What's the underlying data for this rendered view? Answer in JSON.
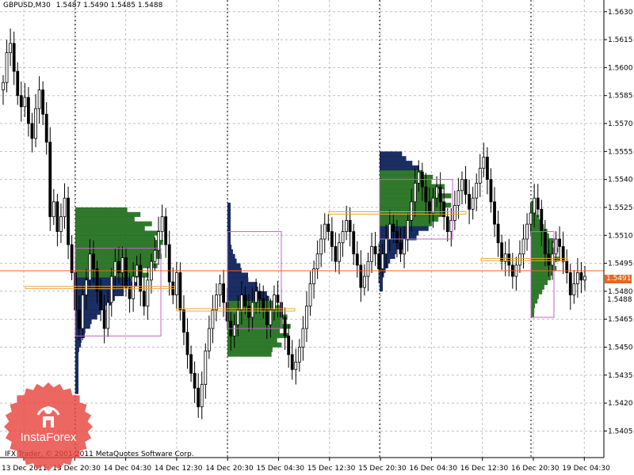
{
  "window": {
    "symbol": "GBPUSD,M30",
    "ohlc": "1.5487 1.5490 1.5485 1.5488",
    "copyright": "IFX Trader, © 2001-2011 MetaQuotes Software Corp.",
    "current_price": "1.5491",
    "last_price": "1.5488"
  },
  "watermark": {
    "text": "InstaForex",
    "color": "#e8463f"
  },
  "colors": {
    "background": "#ffffff",
    "grid": "#c0c0c0",
    "candle": "#000000",
    "profile_dark": "#071c55",
    "profile_green": "#1e6e1a",
    "value_area_box": "#c264c8",
    "poc_line": "#e8a83a",
    "price_line": "#e8661f",
    "separator": "#000000"
  },
  "chart_data": {
    "type": "candlestick",
    "symbol": "GBPUSD",
    "timeframe": "M30",
    "y_axis": {
      "ylim": [
        1.5395,
        1.5635
      ],
      "ticks": [
        "1.5630",
        "1.5615",
        "1.5600",
        "1.5585",
        "1.5570",
        "1.5555",
        "1.5540",
        "1.5525",
        "1.5510",
        "1.5495",
        "1.5480",
        "1.5465",
        "1.5450",
        "1.5435",
        "1.5420",
        "1.5405"
      ]
    },
    "x_axis": {
      "ticks": [
        "13 Dec 2011",
        "13 Dec 20:30",
        "14 Dec 04:30",
        "14 Dec 12:30",
        "14 Dec 20:30",
        "15 Dec 04:30",
        "15 Dec 12:30",
        "15 Dec 20:30",
        "16 Dec 04:30",
        "16 Dec 12:30",
        "16 Dec 20:30",
        "19 Dec 04:30"
      ]
    },
    "close": [
      1.5592,
      1.5608,
      1.5613,
      1.5598,
      1.5585,
      1.5579,
      1.5584,
      1.557,
      1.5562,
      1.5578,
      1.5588,
      1.5575,
      1.556,
      1.552,
      1.5528,
      1.5512,
      1.552,
      1.553,
      1.5505,
      1.549,
      1.547,
      1.546,
      1.5478,
      1.5486,
      1.55,
      1.5492,
      1.548,
      1.547,
      1.546,
      1.5474,
      1.5488,
      1.5496,
      1.549,
      1.5498,
      1.5482,
      1.5476,
      1.5488,
      1.5494,
      1.548,
      1.5472,
      1.5486,
      1.5496,
      1.5502,
      1.5512,
      1.552,
      1.5505,
      1.5485,
      1.5478,
      1.549,
      1.547,
      1.5458,
      1.5446,
      1.5436,
      1.5428,
      1.5418,
      1.543,
      1.5448,
      1.546,
      1.547,
      1.5478,
      1.5484,
      1.5474,
      1.5464,
      1.5456,
      1.5462,
      1.547,
      1.5478,
      1.5472,
      1.5466,
      1.5474,
      1.548,
      1.5476,
      1.547,
      1.5462,
      1.547,
      1.5478,
      1.5474,
      1.5466,
      1.5456,
      1.5446,
      1.5438,
      1.5442,
      1.545,
      1.546,
      1.5472,
      1.5484,
      1.5492,
      1.55,
      1.5508,
      1.5516,
      1.5512,
      1.5504,
      1.5496,
      1.5506,
      1.5512,
      1.5518,
      1.5512,
      1.55,
      1.5494,
      1.5482,
      1.5488,
      1.5496,
      1.5504,
      1.55,
      1.5492,
      1.55,
      1.5508,
      1.5516,
      1.5512,
      1.5506,
      1.55,
      1.5508,
      1.5518,
      1.5528,
      1.5538,
      1.5544,
      1.5536,
      1.5528,
      1.5522,
      1.553,
      1.5536,
      1.5528,
      1.552,
      1.5512,
      1.5518,
      1.5526,
      1.5534,
      1.554,
      1.5532,
      1.5524,
      1.553,
      1.5538,
      1.5546,
      1.5552,
      1.554,
      1.5528,
      1.5516,
      1.5506,
      1.5496,
      1.55,
      1.5494,
      1.5488,
      1.5494,
      1.55,
      1.5508,
      1.5516,
      1.5522,
      1.553,
      1.5524,
      1.5512,
      1.55,
      1.5494,
      1.55,
      1.5508,
      1.5504,
      1.5496,
      1.549,
      1.5478,
      1.5484,
      1.549,
      1.5486,
      1.5488
    ]
  }
}
